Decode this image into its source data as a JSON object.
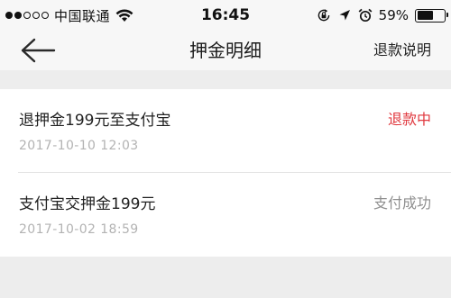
{
  "status_bar": {
    "signal_dots_filled": 2,
    "signal_dots_total": 5,
    "carrier": "中国联通",
    "time": "16:45",
    "battery_percent": "59%",
    "battery_level": 0.59,
    "icons": [
      "wifi-icon",
      "orientation-lock-icon",
      "location-arrow-icon",
      "alarm-icon",
      "battery-icon"
    ]
  },
  "nav": {
    "back_icon": "back-arrow-icon",
    "title": "押金明细",
    "action_label": "退款说明"
  },
  "records": [
    {
      "title": "退押金199元至支付宝",
      "date": "2017-10-10  12:03",
      "status": "退款中",
      "status_color": "#e0383e"
    },
    {
      "title": "支付宝交押金199元",
      "date": "2017-10-02  18:59",
      "status": "支付成功",
      "status_color": "#8f8f8f"
    }
  ],
  "colors": {
    "background": "#ededed",
    "bar_background": "#f7f7f7",
    "list_background": "#ffffff",
    "refund_status": "#e0383e",
    "success_status": "#8f8f8f",
    "date_text": "#b3b3b3"
  }
}
